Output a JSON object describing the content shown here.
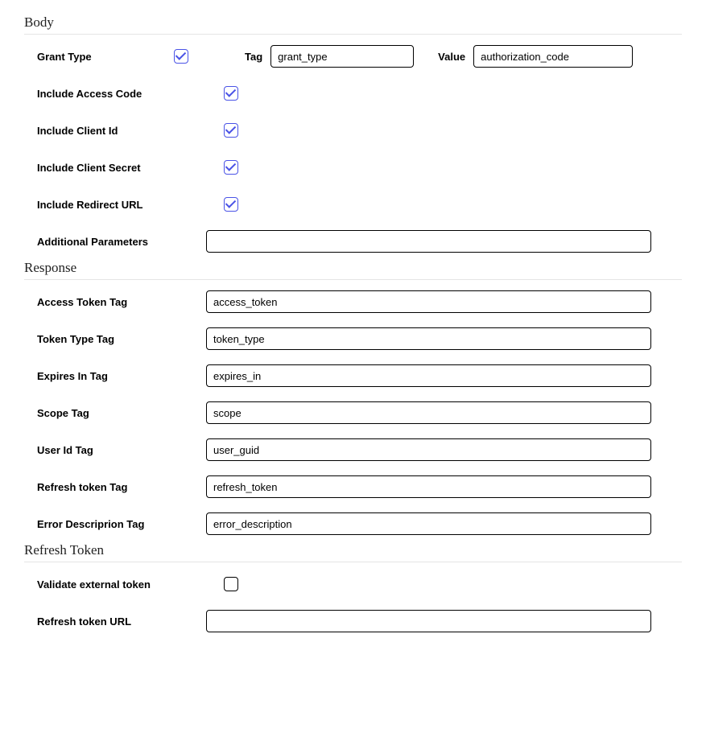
{
  "body": {
    "title": "Body",
    "grant_type_label": "Grant Type",
    "grant_type_checked": true,
    "tag_label": "Tag",
    "tag_value": "grant_type",
    "value_label": "Value",
    "value_value": "authorization_code",
    "include_access_code_label": "Include Access Code",
    "include_access_code_checked": true,
    "include_client_id_label": "Include Client Id",
    "include_client_id_checked": true,
    "include_client_secret_label": "Include Client Secret",
    "include_client_secret_checked": true,
    "include_redirect_url_label": "Include Redirect URL",
    "include_redirect_url_checked": true,
    "additional_parameters_label": "Additional Parameters",
    "additional_parameters_value": ""
  },
  "response": {
    "title": "Response",
    "access_token_tag_label": "Access Token Tag",
    "access_token_tag_value": "access_token",
    "token_type_tag_label": "Token Type Tag",
    "token_type_tag_value": "token_type",
    "expires_in_tag_label": "Expires In Tag",
    "expires_in_tag_value": "expires_in",
    "scope_tag_label": "Scope Tag",
    "scope_tag_value": "scope",
    "user_id_tag_label": "User Id Tag",
    "user_id_tag_value": "user_guid",
    "refresh_token_tag_label": "Refresh token Tag",
    "refresh_token_tag_value": "refresh_token",
    "error_description_tag_label": "Error Descriprion Tag",
    "error_description_tag_value": "error_description"
  },
  "refresh_token": {
    "title": "Refresh Token",
    "validate_external_token_label": "Validate external token",
    "validate_external_token_checked": false,
    "refresh_token_url_label": "Refresh token URL",
    "refresh_token_url_value": ""
  }
}
